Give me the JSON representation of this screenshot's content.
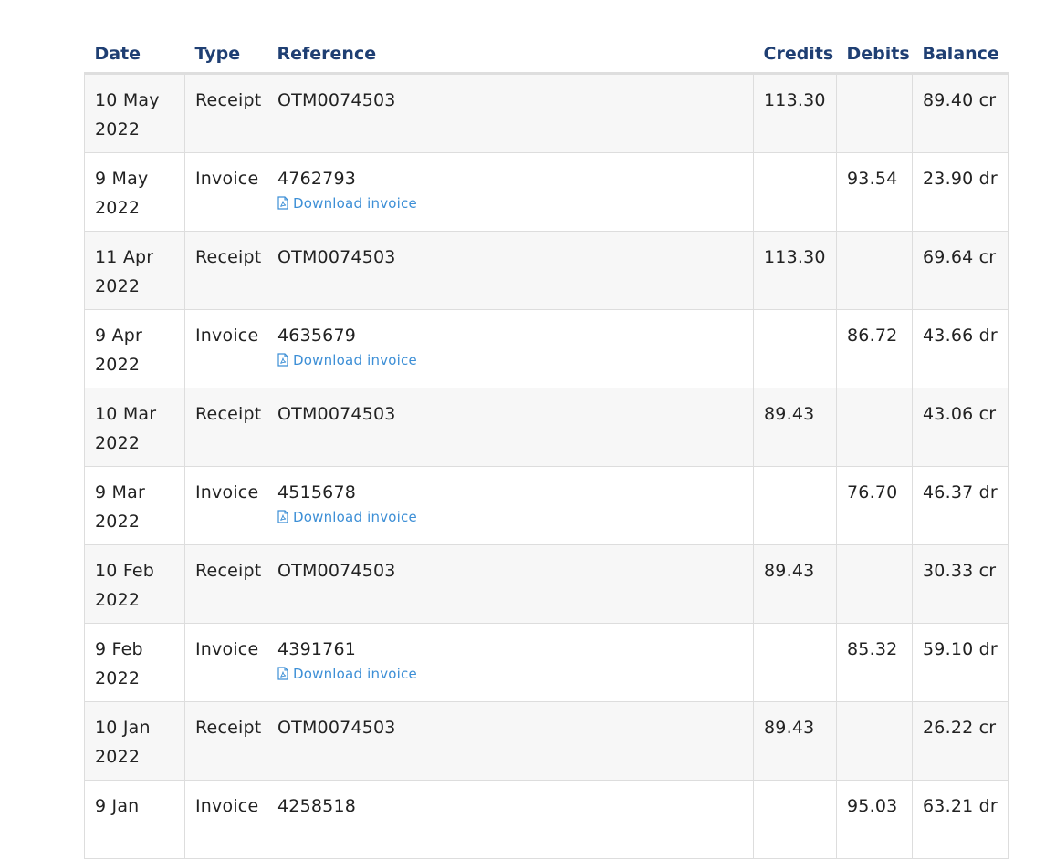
{
  "headers": {
    "date": "Date",
    "type": "Type",
    "reference": "Reference",
    "credits": "Credits",
    "debits": "Debits",
    "balance": "Balance"
  },
  "download_label": "Download invoice",
  "icons": {
    "download": "pdf-file-icon"
  },
  "colors": {
    "header": "#1f3f73",
    "link": "#3d8fd6",
    "stripe": "#f7f7f7"
  },
  "rows": [
    {
      "date": "10 May 2022",
      "type": "Receipt",
      "reference": "OTM0074503",
      "credits": "113.30",
      "debits": "",
      "balance": "89.40 cr"
    },
    {
      "date": "9 May 2022",
      "type": "Invoice",
      "reference": "4762793",
      "credits": "",
      "debits": "93.54",
      "balance": "23.90 dr",
      "download": true
    },
    {
      "date": "11 Apr 2022",
      "type": "Receipt",
      "reference": "OTM0074503",
      "credits": "113.30",
      "debits": "",
      "balance": "69.64 cr"
    },
    {
      "date": "9 Apr 2022",
      "type": "Invoice",
      "reference": "4635679",
      "credits": "",
      "debits": "86.72",
      "balance": "43.66 dr",
      "download": true
    },
    {
      "date": "10 Mar 2022",
      "type": "Receipt",
      "reference": "OTM0074503",
      "credits": "89.43",
      "debits": "",
      "balance": "43.06 cr"
    },
    {
      "date": "9 Mar 2022",
      "type": "Invoice",
      "reference": "4515678",
      "credits": "",
      "debits": "76.70",
      "balance": "46.37 dr",
      "download": true
    },
    {
      "date": "10 Feb 2022",
      "type": "Receipt",
      "reference": "OTM0074503",
      "credits": "89.43",
      "debits": "",
      "balance": "30.33 cr"
    },
    {
      "date": "9 Feb 2022",
      "type": "Invoice",
      "reference": "4391761",
      "credits": "",
      "debits": "85.32",
      "balance": "59.10 dr",
      "download": true
    },
    {
      "date": "10 Jan 2022",
      "type": "Receipt",
      "reference": "OTM0074503",
      "credits": "89.43",
      "debits": "",
      "balance": "26.22 cr"
    },
    {
      "date": "9 Jan",
      "type": "Invoice",
      "reference": "4258518",
      "credits": "",
      "debits": "95.03",
      "balance": "63.21 dr"
    }
  ]
}
